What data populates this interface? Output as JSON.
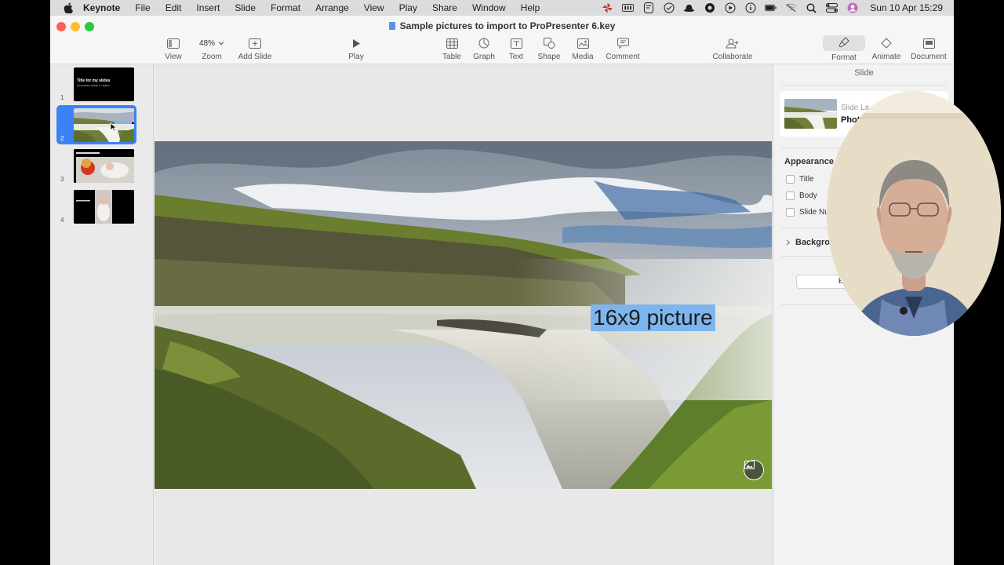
{
  "menubar": {
    "apple_icon": "apple-logo-icon",
    "items": [
      "Keynote",
      "File",
      "Edit",
      "Insert",
      "Slide",
      "Format",
      "Arrange",
      "View",
      "Play",
      "Share",
      "Window",
      "Help"
    ],
    "clock": "Sun 10 Apr  15:29",
    "status_icons": [
      "pinwheel-icon",
      "keyboard-icon",
      "grammarly-icon",
      "check-circle-icon",
      "hat-icon",
      "circle-dot-icon",
      "play-circle-icon",
      "info-circle-icon",
      "battery-icon",
      "wifi-off-icon",
      "search-icon",
      "control-center-icon",
      "avatar-icon"
    ]
  },
  "window": {
    "title": "Sample pictures to import to ProPresenter 6.key"
  },
  "toolbar": {
    "view": "View",
    "zoom_value": "48%",
    "zoom": "Zoom",
    "add_slide": "Add Slide",
    "play": "Play",
    "table": "Table",
    "graph": "Graph",
    "text": "Text",
    "shape": "Shape",
    "media": "Media",
    "comment": "Comment",
    "collaborate": "Collaborate",
    "format": "Format",
    "animate": "Animate",
    "document": "Document"
  },
  "navigator": {
    "slides": [
      {
        "number": "1",
        "title": "Title for my slides",
        "subtitle": "Presentation subtitle or \"tagline\"",
        "selected": false
      },
      {
        "number": "2",
        "selected": true
      },
      {
        "number": "3",
        "selected": false
      },
      {
        "number": "4",
        "selected": false
      }
    ]
  },
  "slide": {
    "text_box": "16x9 picture"
  },
  "inspector": {
    "tab": "Slide",
    "layout_caption": "Slide La",
    "layout_name": "Phot",
    "appearance": "Appearance",
    "checkboxes": [
      "Title",
      "Body",
      "Slide Nu"
    ],
    "background": "Backgrou",
    "edit_button": "Ed"
  },
  "colors": {
    "selection": "#3b82f6",
    "text_highlight": "#7db6ee",
    "close": "#ff5f57",
    "minimize": "#febc2e",
    "zoom": "#28c840"
  }
}
